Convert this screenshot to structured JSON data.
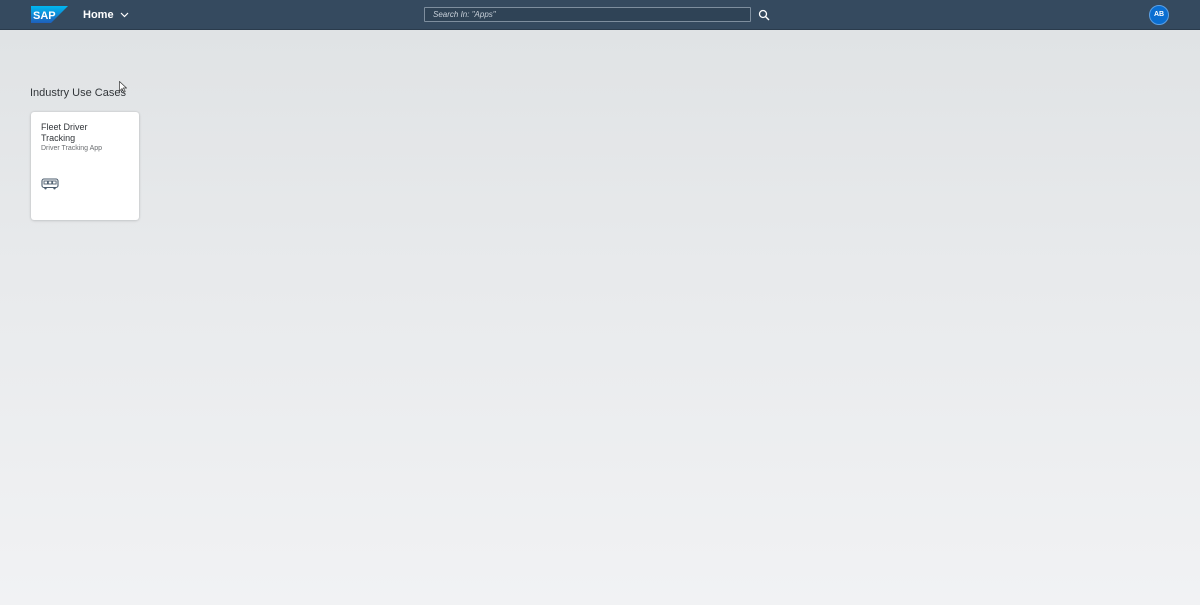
{
  "shell": {
    "logo_text": "SAP",
    "home_label": "Home",
    "search_placeholder": "Search In: \"Apps\"",
    "avatar_initials": "AB",
    "colors": {
      "shell_bg": "#354a5f",
      "avatar_bg": "#0a6ed1"
    }
  },
  "main": {
    "group_title": "Industry Use Cases",
    "tiles": [
      {
        "title": "Fleet Driver Tracking",
        "subtitle": "Driver Tracking App",
        "icon": "bus-icon"
      }
    ]
  }
}
